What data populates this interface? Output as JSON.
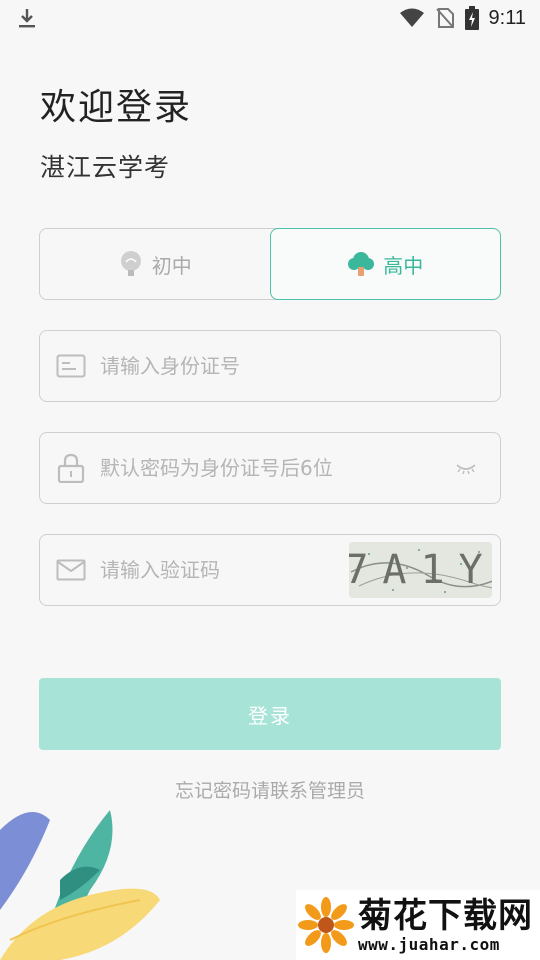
{
  "status_bar": {
    "time": "9:11",
    "icons": [
      "download-icon",
      "wifi-icon",
      "no-sim-icon",
      "battery-charging-icon"
    ]
  },
  "header": {
    "title": "欢迎登录",
    "subtitle": "湛江云学考"
  },
  "school_level": {
    "options": [
      {
        "label": "初中",
        "icon": "tree-bulb-icon",
        "selected": false
      },
      {
        "label": "高中",
        "icon": "tree-icon",
        "selected": true
      }
    ]
  },
  "form": {
    "id_placeholder": "请输入身份证号",
    "password_placeholder": "默认密码为身份证号后6位",
    "captcha_placeholder": "请输入验证码",
    "captcha_text": "7A1Y"
  },
  "login_button": "登录",
  "forgot_text": "忘记密码请联系管理员",
  "watermark": {
    "title": "菊花下载网",
    "url": "www.juahar.com"
  },
  "colors": {
    "accent": "#3bb89c",
    "button": "#a7e3d7",
    "background": "#f7f7f7"
  }
}
